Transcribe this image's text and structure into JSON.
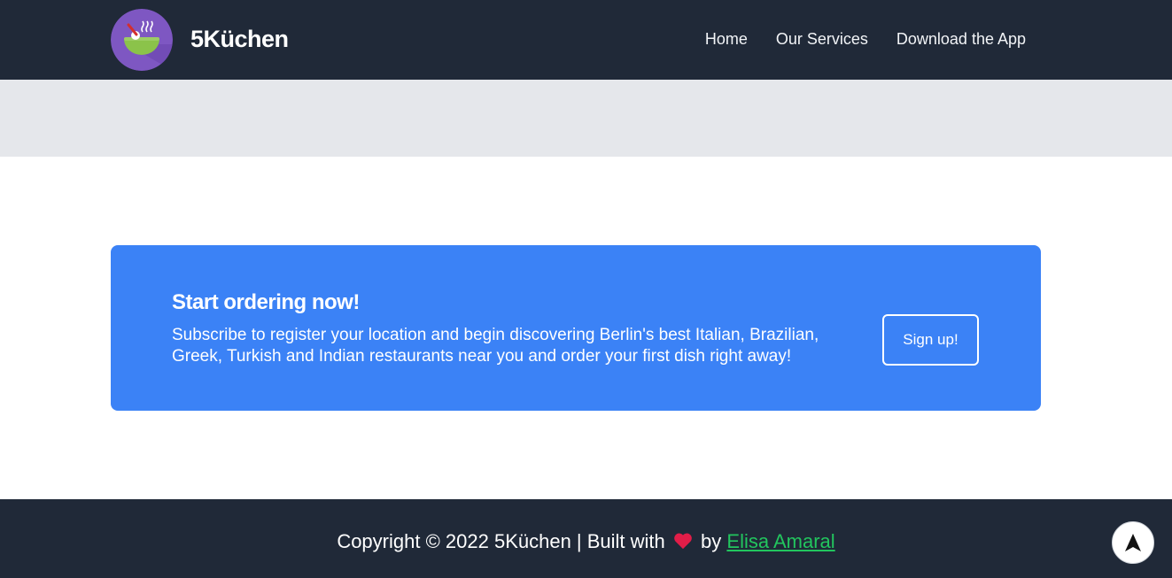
{
  "header": {
    "brand": "5Küchen",
    "nav": [
      {
        "label": "Home"
      },
      {
        "label": "Our Services"
      },
      {
        "label": "Download the App"
      }
    ],
    "logo_icon": "soup-bowl-icon"
  },
  "cta": {
    "title": "Start ordering now!",
    "text": "Subscribe to register your location and begin discovering Berlin's best Italian, Brazilian, Greek, Turkish and Indian restaurants near you and order your first dish right away!",
    "button_label": "Sign up!"
  },
  "footer": {
    "copyright_prefix": "Copyright © 2022 5Küchen | Built with",
    "by_text": "by",
    "author": "Elisa Amaral",
    "heart_icon": "heart-icon"
  },
  "scroll_top": {
    "icon": "arrow-up-icon"
  },
  "colors": {
    "header_bg": "#202938",
    "strip_bg": "#e5e7eb",
    "cta_bg": "#3b82f6",
    "link_green": "#22c55e",
    "heart_red": "#e11d48"
  }
}
